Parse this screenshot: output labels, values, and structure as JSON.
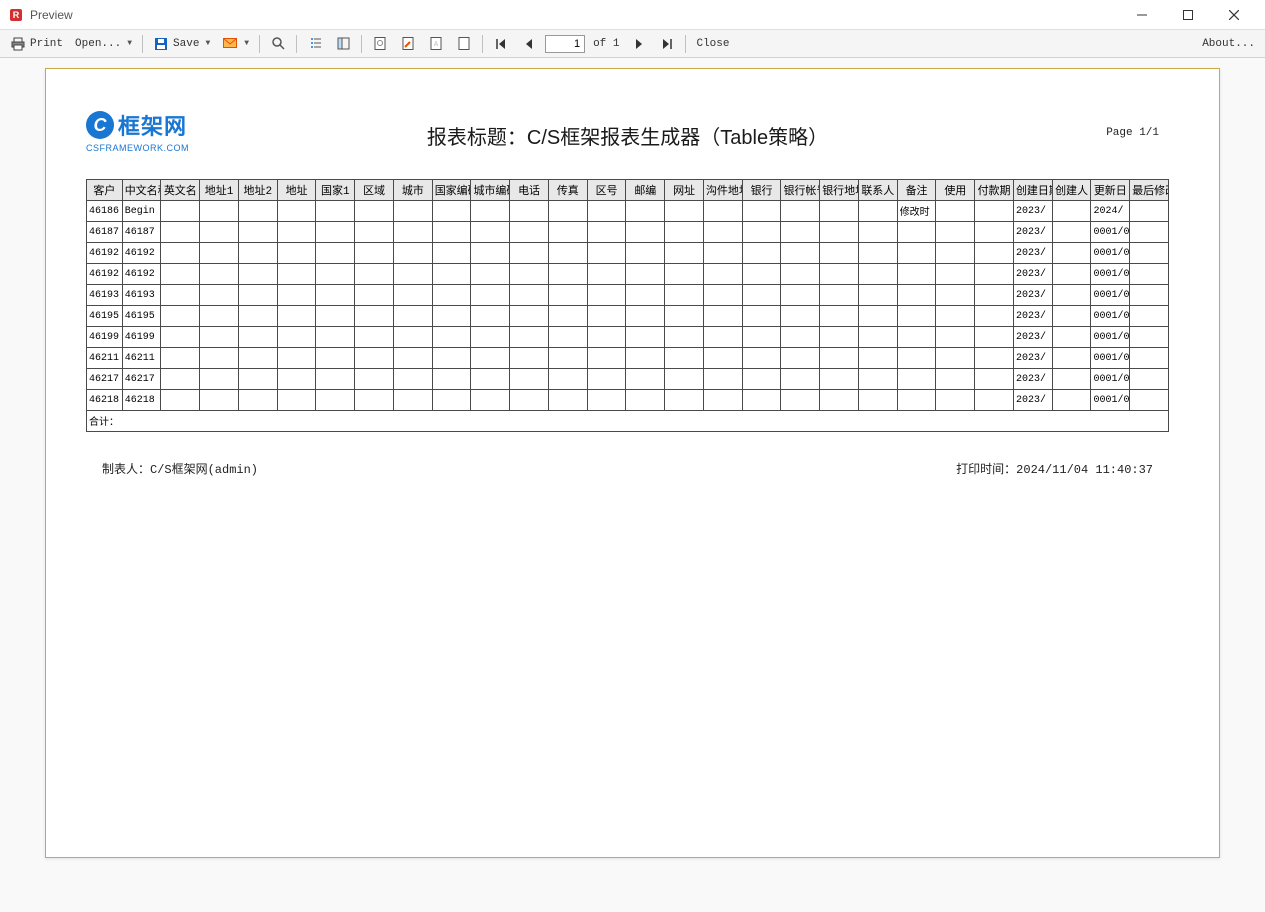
{
  "window": {
    "title": "Preview"
  },
  "toolbar": {
    "print": "Print",
    "open": "Open...",
    "save": "Save",
    "page_current": "1",
    "page_of": "of 1",
    "close": "Close",
    "about": "About..."
  },
  "logo": {
    "brand_cn": "框架网",
    "brand_sub": "CSFRAMEWORK.COM"
  },
  "report": {
    "title": "报表标题：C/S框架报表生成器（Table策略）",
    "page_label": "Page 1/1",
    "author": "制表人：C/S框架网(admin)",
    "print_time": "打印时间：2024/11/04 11:40:37",
    "sum_label": "合计："
  },
  "columns": [
    "客户",
    "中文名称",
    "英文名",
    "地址1",
    "地址2",
    "地址",
    "国家1",
    "区域",
    "城市",
    "国家编码",
    "城市编码",
    "电话",
    "传真",
    "区号",
    "邮编",
    "网址",
    "沟件地址",
    "银行",
    "银行帐号",
    "银行地址",
    "联系人",
    "备注",
    "使用",
    "付款期",
    "创建日期",
    "创建人",
    "更新日",
    "最后修改"
  ],
  "rows": [
    {
      "c0": "46186",
      "c1": "Begin",
      "c21": "修改时",
      "c24": "2023/",
      "c26": "2024/"
    },
    {
      "c0": "46187",
      "c1": "46187",
      "c24": "2023/",
      "c26": "0001/0"
    },
    {
      "c0": "46192",
      "c1": "46192",
      "c24": "2023/",
      "c26": "0001/0"
    },
    {
      "c0": "46192",
      "c1": "46192",
      "c24": "2023/",
      "c26": "0001/0"
    },
    {
      "c0": "46193",
      "c1": "46193",
      "c24": "2023/",
      "c26": "0001/0"
    },
    {
      "c0": "46195",
      "c1": "46195",
      "c24": "2023/",
      "c26": "0001/0"
    },
    {
      "c0": "46199",
      "c1": "46199",
      "c24": "2023/",
      "c26": "0001/0"
    },
    {
      "c0": "46211",
      "c1": "46211",
      "c24": "2023/",
      "c26": "0001/0"
    },
    {
      "c0": "46217",
      "c1": "46217",
      "c24": "2023/",
      "c26": "0001/0"
    },
    {
      "c0": "46218",
      "c1": "46218",
      "c24": "2023/",
      "c26": "0001/0"
    }
  ]
}
